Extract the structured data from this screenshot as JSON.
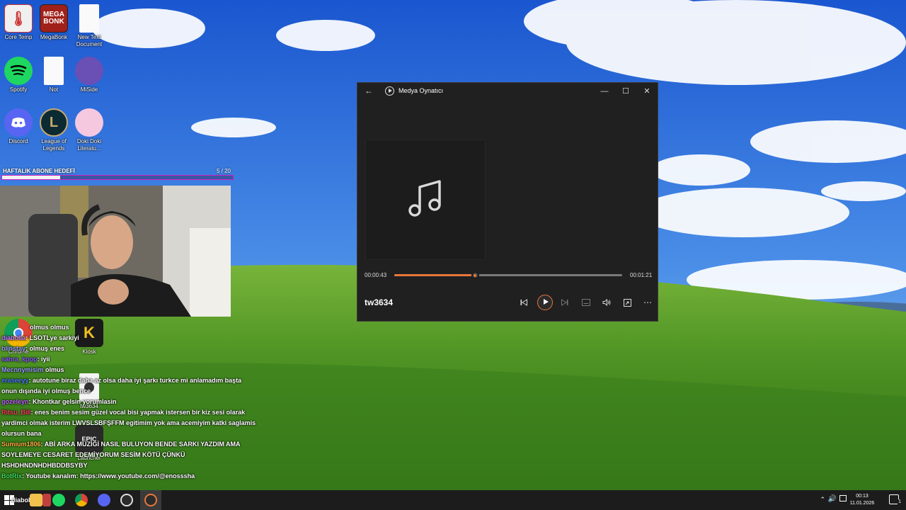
{
  "desktop": {
    "icons": [
      {
        "label": "Core Temp"
      },
      {
        "label": "MegaBonk"
      },
      {
        "label": "New Text Document"
      },
      {
        "label": "Spotify"
      },
      {
        "label": "Not"
      },
      {
        "label": "MiSide"
      },
      {
        "label": "Discord"
      },
      {
        "label": "League of Legends"
      },
      {
        "label": "Doki Doki Literatu..."
      },
      {
        "label": "Chrome"
      },
      {
        "label": "Kiosk"
      },
      {
        "label": "tw3634"
      },
      {
        "label": "Launcher"
      }
    ],
    "megabonk_text": "MEGA BONK"
  },
  "overlay": {
    "sub_goal_title": "HAFTALIK ABONE HEDEFİ",
    "sub_goal_count": "5 / 20",
    "sub_goal_progress": 0.25
  },
  "chat": {
    "lines": [
      {
        "user": "",
        "message": "olmus olmus"
      },
      {
        "user": "diabolia",
        "message": ": LSOTLye sarkiyi"
      },
      {
        "user": "blinstay",
        "message": ": olmuş enes"
      },
      {
        "user": "sahra_kpop",
        "message": ": iyii"
      },
      {
        "user": "Mecnnymisim",
        "message": "olmus"
      },
      {
        "user": "eraseeyy",
        "message": ": autotune biraz daha az olsa daha iyi şarkı turkce mi anlamadım başta onun dışında iyi olmuş bence"
      },
      {
        "user": "gozeleyn",
        "message": ": Khontkar gelsin yorumlasin"
      },
      {
        "user": "Ritsu_Bill",
        "message": ": enes benim sesim güzel vocal bisi yapmak istersen bir kiz sesi olarak yardimci olmak isterim LWVSLSBFŞFFM egitimim yok ama acemiyim katki saglamis olursun bana"
      },
      {
        "user": "Sumium1806",
        "message": ": ABİ ARKA MÜZİĞİ NASIL BULUYON BENDE SARKI YAZDIM AMA SOYLEMEYE CESARET EDEMİYORUM SESİM KÖTÜ ÇÜNKÜ HSHDHNDNHDHBDDBSYBY"
      },
      {
        "user": "BotRix",
        "message": ": Youtube kanalım: https://www.youtube.com/@enosssha"
      },
      {
        "user": "diabolia",
        "message": ""
      }
    ]
  },
  "player": {
    "title": "Medya Oynatıcı",
    "current_time": "00:00:43",
    "total_time": "00:01:21",
    "progress": 0.353,
    "song_title": "tw3634",
    "accent": "#e8773b"
  },
  "taskbar": {
    "time": "00:13",
    "date": "11.01.2026",
    "notification_count": "1"
  }
}
